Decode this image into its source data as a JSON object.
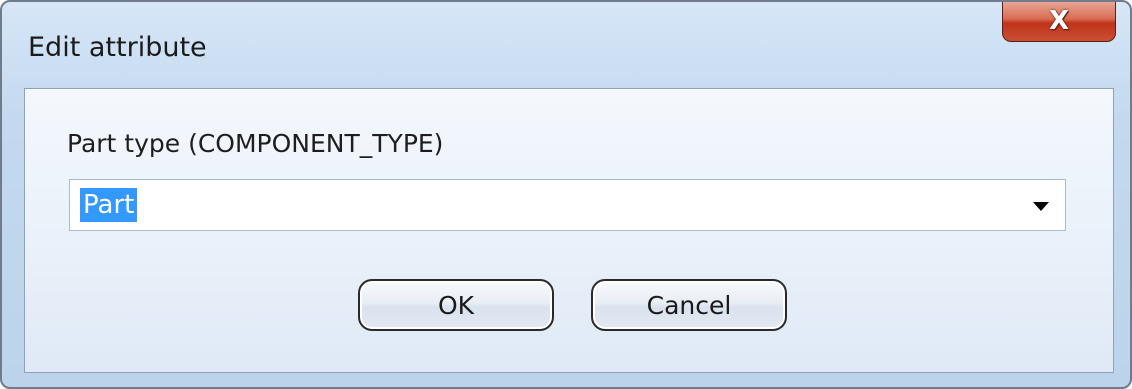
{
  "window": {
    "title": "Edit attribute",
    "close_label": "X"
  },
  "field": {
    "label": "Part type (COMPONENT_TYPE)",
    "selected_value": "Part"
  },
  "buttons": {
    "ok_label": "OK",
    "cancel_label": "Cancel"
  }
}
